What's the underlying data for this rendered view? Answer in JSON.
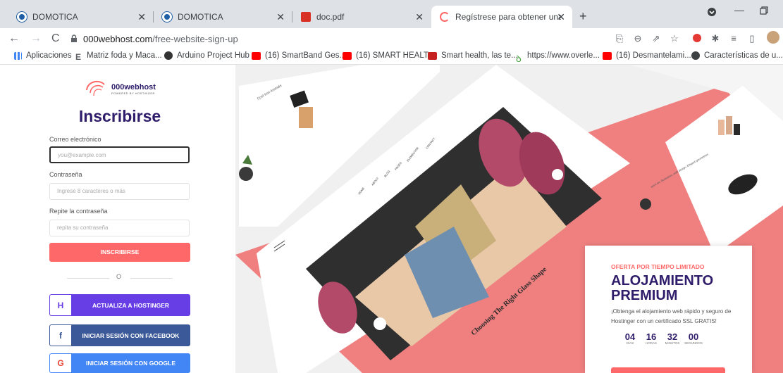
{
  "tabs": [
    {
      "title": "DOMOTICA",
      "favicon_color": "#1f5fa6"
    },
    {
      "title": "DOMOTICA",
      "favicon_color": "#1f5fa6"
    },
    {
      "title": "doc.pdf",
      "favicon_color": "#d93025"
    },
    {
      "title": "Regístrese para obtener una cue",
      "favicon_color": "#ff6868"
    }
  ],
  "address": {
    "domain": "000webhost.com",
    "path": "/free-website-sign-up"
  },
  "bookmarks": [
    {
      "label": "Aplicaciones",
      "color": "#4285f4"
    },
    {
      "label": "Matriz foda y Maca...",
      "color": "#5f6368"
    },
    {
      "label": "Arduino Project Hub",
      "color": "#333333"
    },
    {
      "label": "(16) SmartBand Ges...",
      "color": "#ff0000"
    },
    {
      "label": "(16) SMART HEALT...",
      "color": "#ff0000"
    },
    {
      "label": "Smart health, las te...",
      "color": "#c5221f"
    },
    {
      "label": "https://www.overle...",
      "color": "#47a141"
    },
    {
      "label": "(16) Desmantelami...",
      "color": "#ff0000"
    },
    {
      "label": "Características de u...",
      "color": "#3c4043"
    }
  ],
  "signup": {
    "logo_name": "000webhost",
    "logo_sub": "POWERED BY HOSTINGER",
    "title": "Inscribirse",
    "email_label": "Correo electrónico",
    "email_placeholder": "you@example.com",
    "password_label": "Contraseña",
    "password_placeholder": "Ingrese 8 caracteres o más",
    "repeat_label": "Repite la contraseña",
    "repeat_placeholder": "repita su contraseña",
    "submit_label": "INSCRIBIRSE",
    "or_text": "O",
    "hostinger_label": "ACTUALIZA A HOSTINGER",
    "facebook_label": "INICIAR SESIÓN CON FACEBOOK",
    "google_label": "INICIAR SESIÓN CON GOOGLE"
  },
  "colors": {
    "accent": "#ff6868",
    "brand": "#2f1c6a",
    "hostinger": "#673de6",
    "facebook": "#3b5998",
    "google": "#4285f4"
  },
  "hero": {
    "nav_items": [
      "HOME",
      "ABOUT",
      "BLOG",
      "PAGES",
      "ELEMENTOR",
      "CONTACT"
    ],
    "post_title": "Choosing The Right Glass Shape",
    "side_caption_1": "Cool Iron Animals",
    "side_caption_2": "sport art, illustration, web design, Elegant geometries"
  },
  "offer": {
    "tag": "OFERTA POR TIEMPO LIMITADO",
    "title_line1": "ALOJAMIENTO",
    "title_line2": "PREMIUM",
    "description": "¡Obtenga el alojamiento web rápido y seguro de Hostinger con un certificado SSL GRATIS!",
    "countdown": [
      {
        "value": "04",
        "unit": "DÍAS"
      },
      {
        "value": "16",
        "unit": "HORAS"
      },
      {
        "value": "32",
        "unit": "MINUTOS"
      },
      {
        "value": "00",
        "unit": "SEGUNDOS"
      }
    ]
  }
}
